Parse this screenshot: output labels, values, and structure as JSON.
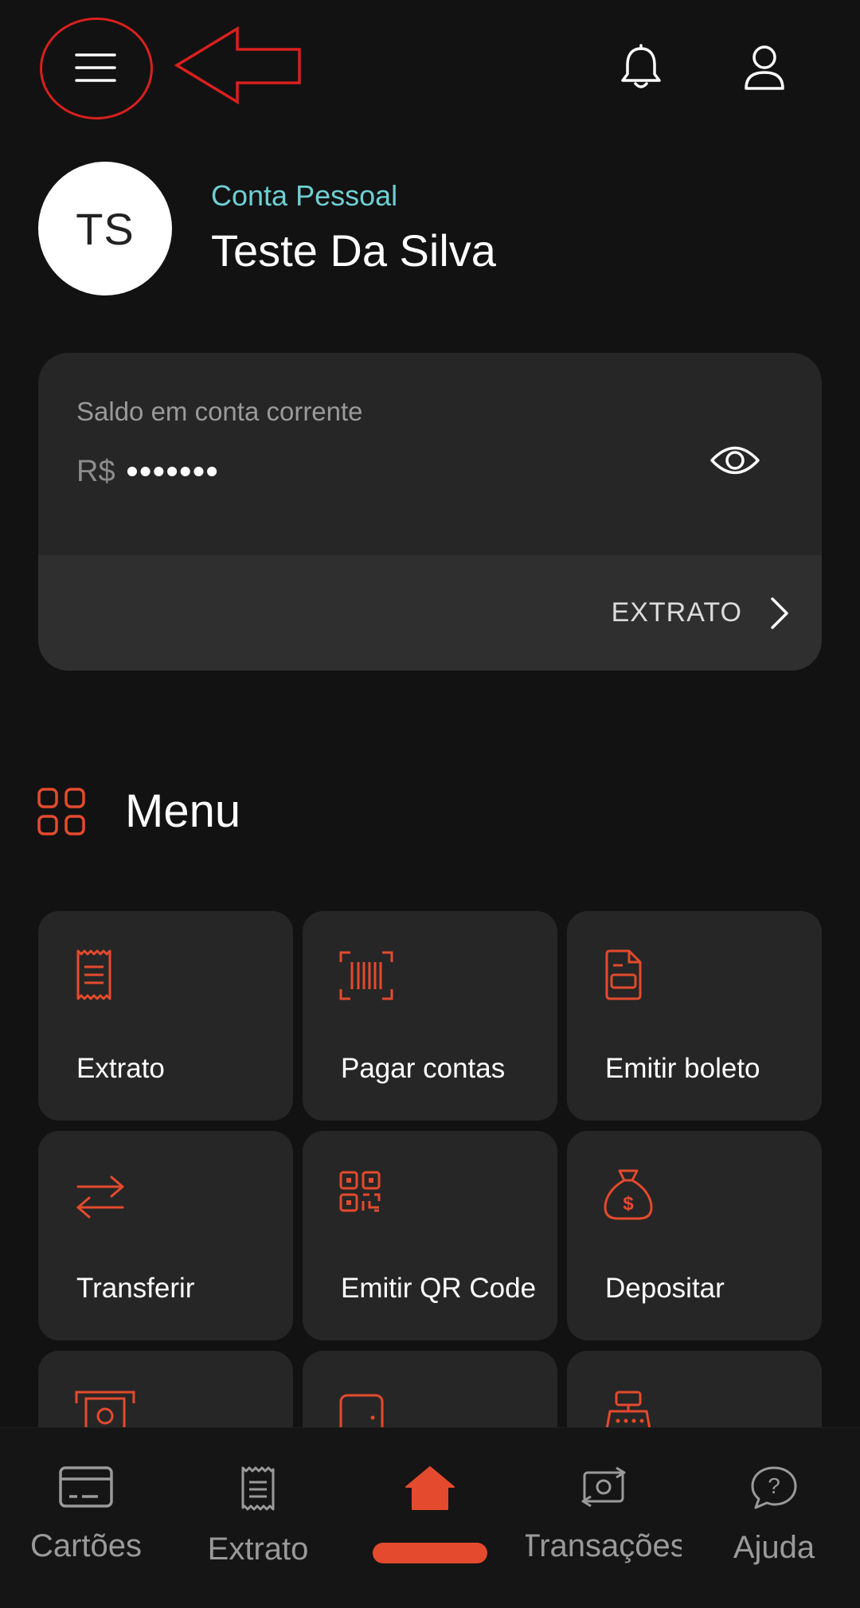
{
  "colors": {
    "background": "#121212",
    "card": "#262626",
    "accent": "#e44a2d",
    "account_type": "#6ecfd3",
    "annotation": "#d9201e"
  },
  "header": {
    "menu_icon": "hamburger-menu-icon",
    "notification_icon": "bell-icon",
    "profile_icon": "user-icon"
  },
  "profile": {
    "initials": "TS",
    "account_type": "Conta Pessoal",
    "name": "Teste Da Silva"
  },
  "balance": {
    "label": "Saldo em conta corrente",
    "currency": "R$",
    "masked_value": "•••••••",
    "visibility_icon": "eye-icon",
    "extrato_label": "EXTRATO"
  },
  "menu": {
    "title": "Menu",
    "items": [
      {
        "label": "Extrato",
        "icon": "receipt-icon"
      },
      {
        "label": "Pagar contas",
        "icon": "barcode-scan-icon"
      },
      {
        "label": "Emitir boleto",
        "icon": "document-icon"
      },
      {
        "label": "Transferir",
        "icon": "transfer-arrows-icon"
      },
      {
        "label": "Emitir QR Code",
        "icon": "qr-code-icon"
      },
      {
        "label": "Depositar",
        "icon": "money-bag-icon"
      },
      {
        "label": "",
        "icon": "atm-icon"
      },
      {
        "label": "",
        "icon": "phone-icon"
      },
      {
        "label": "",
        "icon": "cash-register-icon"
      }
    ]
  },
  "bottom_nav": {
    "items": [
      {
        "label": "Cartões",
        "icon": "card-icon"
      },
      {
        "label": "Extrato",
        "icon": "receipt-icon"
      },
      {
        "label": "",
        "icon": "home-icon",
        "active": true
      },
      {
        "label": "Transações",
        "icon": "exchange-money-icon"
      },
      {
        "label": "Ajuda",
        "icon": "help-chat-icon"
      }
    ]
  }
}
